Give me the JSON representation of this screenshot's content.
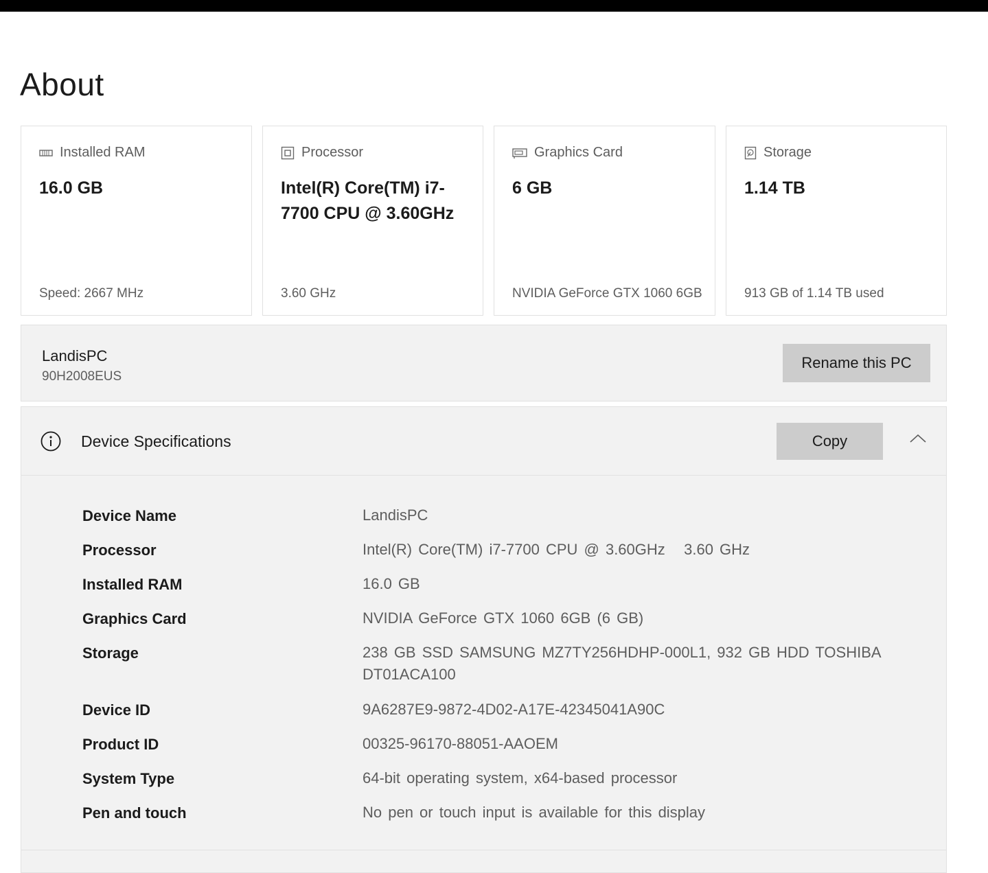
{
  "page": {
    "title": "About"
  },
  "cards": [
    {
      "icon": "memory-icon",
      "label": "Installed RAM",
      "value": "16.0 GB",
      "footer": "Speed: 2667 MHz"
    },
    {
      "icon": "processor-icon",
      "label": "Processor",
      "value": "Intel(R) Core(TM) i7-7700 CPU @ 3.60GHz",
      "footer": "3.60 GHz"
    },
    {
      "icon": "graphics-card-icon",
      "label": "Graphics Card",
      "value": "6 GB",
      "footer": "NVIDIA GeForce GTX 1060 6GB"
    },
    {
      "icon": "storage-icon",
      "label": "Storage",
      "value": "1.14 TB",
      "footer": "913 GB of 1.14 TB used"
    }
  ],
  "pc": {
    "name": "LandisPC",
    "model": "90H2008EUS",
    "rename_label": "Rename this PC"
  },
  "specs": {
    "title": "Device Specifications",
    "copy_label": "Copy",
    "icon": "info-icon",
    "toggle_icon": "chevron-up-icon",
    "rows": [
      {
        "label": "Device Name",
        "value": "LandisPC"
      },
      {
        "label": "Processor",
        "value": "Intel(R) Core(TM) i7-7700 CPU @ 3.60GHz   3.60 GHz"
      },
      {
        "label": "Installed RAM",
        "value": "16.0 GB"
      },
      {
        "label": "Graphics Card",
        "value": "NVIDIA GeForce GTX 1060 6GB (6 GB)"
      },
      {
        "label": "Storage",
        "value": "238 GB SSD SAMSUNG MZ7TY256HDHP-000L1, 932 GB HDD TOSHIBA DT01ACA100"
      },
      {
        "label": "Device ID",
        "value": "9A6287E9-9872-4D02-A17E-42345041A90C"
      },
      {
        "label": "Product ID",
        "value": "00325-96170-88051-AAOEM"
      },
      {
        "label": "System Type",
        "value": "64-bit operating system, x64-based processor"
      },
      {
        "label": "Pen and touch",
        "value": "No pen or touch input is available for this display"
      }
    ]
  }
}
